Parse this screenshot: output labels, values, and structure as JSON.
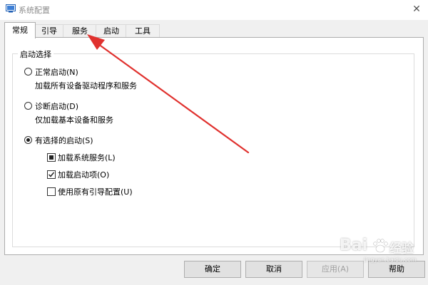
{
  "window": {
    "title": "系统配置",
    "close_glyph": "✕"
  },
  "tabs": [
    {
      "label": "常规",
      "active": true
    },
    {
      "label": "引导",
      "active": false
    },
    {
      "label": "服务",
      "active": false
    },
    {
      "label": "启动",
      "active": false
    },
    {
      "label": "工具",
      "active": false
    }
  ],
  "startup_selection": {
    "group_title": "启动选择",
    "options": [
      {
        "label": "正常启动(N)",
        "description": "加载所有设备驱动程序和服务",
        "selected": false
      },
      {
        "label": "诊断启动(D)",
        "description": "仅加载基本设备和服务",
        "selected": false
      },
      {
        "label": "有选择的启动(S)",
        "selected": true
      }
    ],
    "selective_items": [
      {
        "label": "加载系统服务(L)",
        "state": "mixed"
      },
      {
        "label": "加载启动项(O)",
        "state": "checked"
      },
      {
        "label": "使用原有引导配置(U)",
        "state": "unchecked"
      }
    ]
  },
  "buttons": {
    "ok": "确定",
    "cancel": "取消",
    "apply": "应用(A)",
    "help": "帮助"
  },
  "annotation": {
    "arrow_color": "#e0312e"
  },
  "watermark": {
    "brand": "Bai",
    "brand_suffix": "经验",
    "domain": "jingyan.baidu.com"
  }
}
